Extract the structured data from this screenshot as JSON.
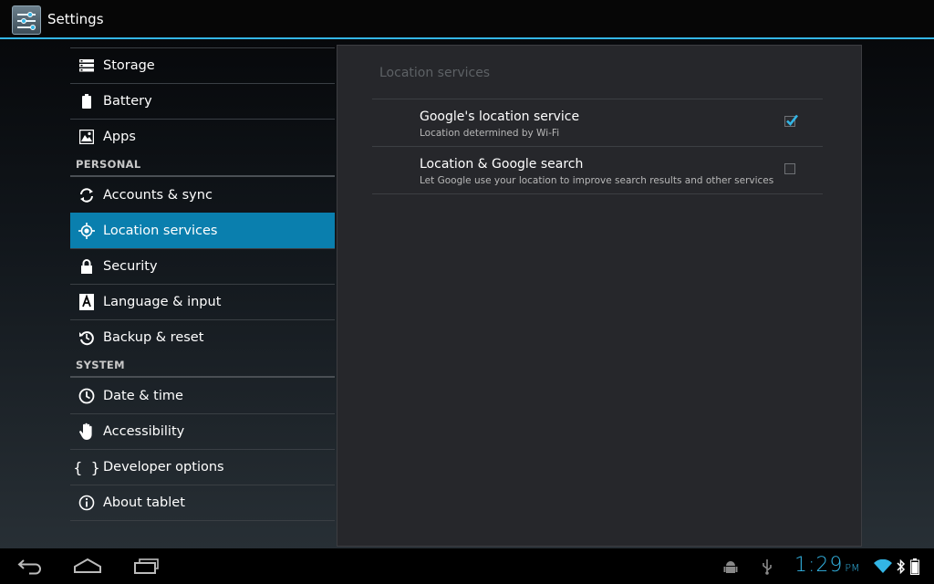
{
  "app": {
    "title": "Settings"
  },
  "left_list": {
    "items_top": [
      {
        "label": "Storage",
        "icon": "storage-icon"
      },
      {
        "label": "Battery",
        "icon": "battery-icon"
      },
      {
        "label": "Apps",
        "icon": "apps-icon"
      }
    ],
    "header_personal": "PERSONAL",
    "items_personal": [
      {
        "label": "Accounts & sync",
        "icon": "sync-icon"
      },
      {
        "label": "Location services",
        "icon": "location-icon",
        "selected": true
      },
      {
        "label": "Security",
        "icon": "lock-icon"
      },
      {
        "label": "Language & input",
        "icon": "language-icon"
      },
      {
        "label": "Backup & reset",
        "icon": "backup-icon"
      }
    ],
    "header_system": "SYSTEM",
    "items_system": [
      {
        "label": "Date & time",
        "icon": "clock-icon"
      },
      {
        "label": "Accessibility",
        "icon": "hand-icon"
      },
      {
        "label": "Developer options",
        "icon": "braces-icon"
      },
      {
        "label": "About tablet",
        "icon": "info-icon"
      }
    ]
  },
  "panel": {
    "title": "Location services",
    "prefs": [
      {
        "title": "Google's location service",
        "summary": "Location determined by Wi-Fi",
        "checked": true
      },
      {
        "title": "Location & Google search",
        "summary": "Let Google use your location to improve search results and other services",
        "checked": false
      }
    ]
  },
  "status": {
    "time": "1:29",
    "ampm": "PM"
  },
  "colors": {
    "accent": "#33b5e5",
    "selected": "#0a7fae"
  }
}
